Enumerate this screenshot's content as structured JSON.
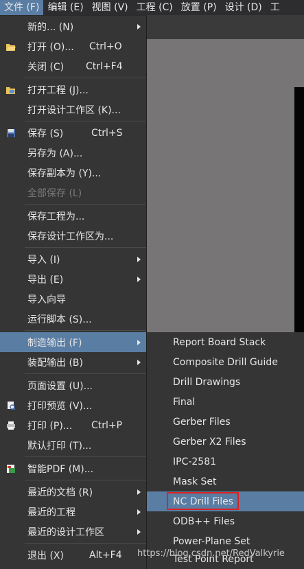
{
  "menubar": [
    {
      "label": "文件 (F)",
      "active": true
    },
    {
      "label": "编辑 (E)"
    },
    {
      "label": "视图 (V)"
    },
    {
      "label": "工程 (C)"
    },
    {
      "label": "放置 (P)"
    },
    {
      "label": "设计 (D)"
    },
    {
      "label": "工"
    }
  ],
  "file_menu": [
    {
      "label": "新的... (N)",
      "submenu": true
    },
    {
      "label": "打开 (O)...",
      "shortcut": "Ctrl+O",
      "icon": "open-folder-icon"
    },
    {
      "label": "关闭 (C)",
      "shortcut": "Ctrl+F4"
    },
    {
      "label": "打开工程 (J)...",
      "icon": "open-project-icon"
    },
    {
      "label": "打开设计工作区 (K)..."
    },
    {
      "label": "保存 (S)",
      "shortcut": "Ctrl+S",
      "icon": "save-icon"
    },
    {
      "label": "另存为 (A)..."
    },
    {
      "label": "保存副本为 (Y)..."
    },
    {
      "label": "全部保存 (L)",
      "disabled": true
    },
    {
      "label": "保存工程为..."
    },
    {
      "label": "保存设计工作区为..."
    },
    {
      "label": "导入 (I)",
      "submenu": true
    },
    {
      "label": "导出 (E)",
      "submenu": true
    },
    {
      "label": "导入向导"
    },
    {
      "label": "运行脚本 (S)..."
    },
    {
      "label": "制造输出 (F)",
      "submenu": true,
      "active": true
    },
    {
      "label": "装配输出 (B)",
      "submenu": true
    },
    {
      "label": "页面设置 (U)..."
    },
    {
      "label": "打印预览 (V)...",
      "icon": "print-preview-icon"
    },
    {
      "label": "打印 (P)...",
      "shortcut": "Ctrl+P",
      "icon": "printer-icon"
    },
    {
      "label": "默认打印 (T)..."
    },
    {
      "label": "智能PDF (M)...",
      "icon": "pdf-icon"
    },
    {
      "label": "最近的文档 (R)",
      "submenu": true
    },
    {
      "label": "最近的工程",
      "submenu": true
    },
    {
      "label": "最近的设计工作区",
      "submenu": true
    },
    {
      "label": "退出 (X)",
      "shortcut": "Alt+F4"
    }
  ],
  "fab_submenu": [
    {
      "label": "Report Board Stack"
    },
    {
      "label": "Composite Drill Guide"
    },
    {
      "label": "Drill Drawings"
    },
    {
      "label": "Final"
    },
    {
      "label": "Gerber Files"
    },
    {
      "label": "Gerber X2 Files"
    },
    {
      "label": "IPC-2581"
    },
    {
      "label": "Mask Set"
    },
    {
      "label": "NC Drill Files",
      "active": true
    },
    {
      "label": "ODB++ Files"
    },
    {
      "label": "Power-Plane Set"
    },
    {
      "label": "Test Point Report"
    }
  ],
  "watermark": "https://blog.csdn.net/RedValkyrie",
  "colors": {
    "highlight": "#5a7da3",
    "menu_bg": "#353535",
    "annotation_box": "#e02020"
  }
}
